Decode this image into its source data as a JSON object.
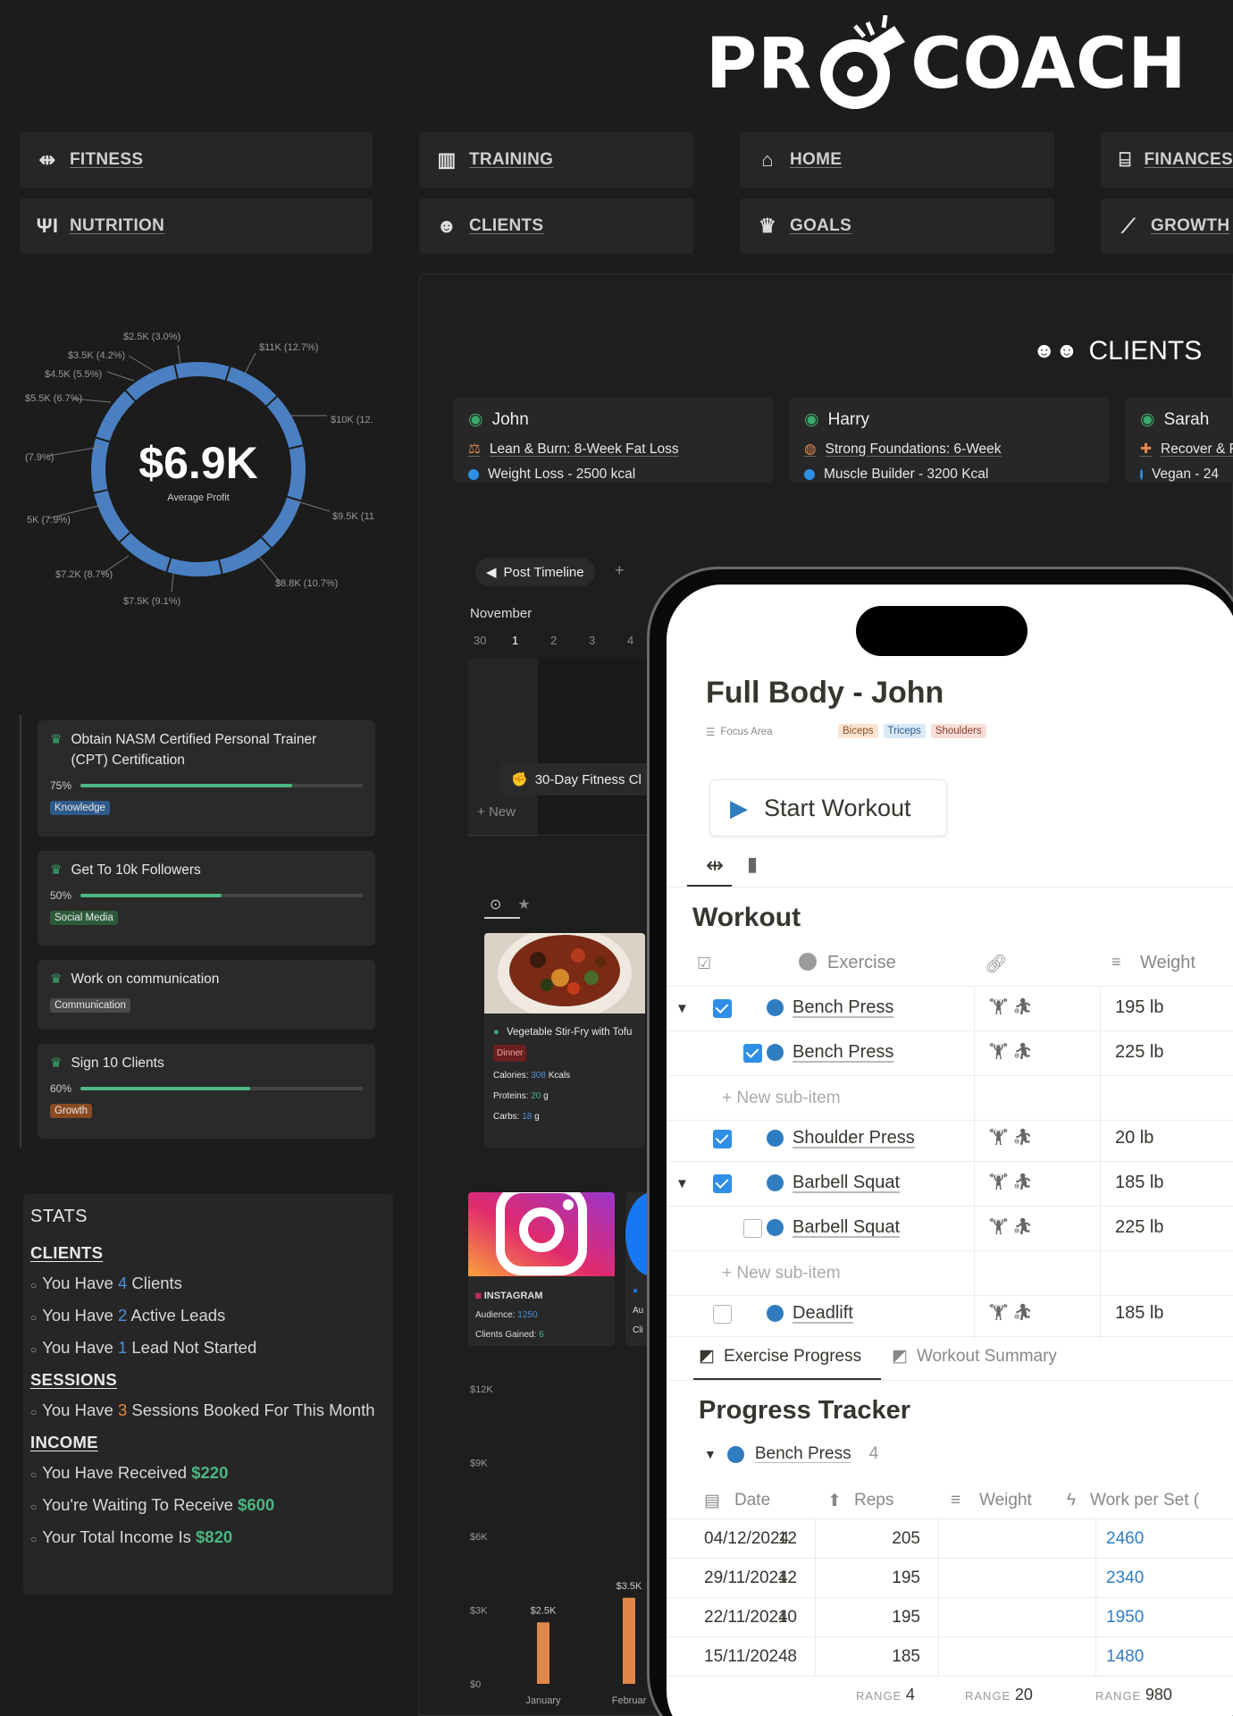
{
  "brand": {
    "name_a": "PR",
    "name_b": "COACH"
  },
  "nav": [
    {
      "label": "FITNESS",
      "icon": "dumbbell-icon"
    },
    {
      "label": "TRAINING",
      "icon": "map-icon"
    },
    {
      "label": "HOME",
      "icon": "home-icon"
    },
    {
      "label": "FINANCES",
      "icon": "bank-icon"
    },
    {
      "label": "NUTRITION",
      "icon": "utensils-icon"
    },
    {
      "label": "CLIENTS",
      "icon": "users-icon"
    },
    {
      "label": "GOALS",
      "icon": "trophy-icon"
    },
    {
      "label": "GROWTH",
      "icon": "chart-line-icon"
    }
  ],
  "donut": {
    "value": "$6.9K",
    "caption": "Average Profit",
    "labels": [
      "$2.5K (3.0%)",
      "$3.5K (4.2%)",
      "$4.5K (5.5%)",
      "$5.5K (6.7%)",
      "(7.9%)",
      "5K (7.9%)",
      "$7.2K (8.7%)",
      "$7.5K (9.1%)",
      "$8.8K (10.7%)",
      "$9.5K (11",
      "$10K (12.",
      "$11K (12.7%)"
    ]
  },
  "goals": [
    {
      "title": "Obtain NASM Certified Personal Trainer (CPT) Certification",
      "percent": "75%",
      "progress": 0.75,
      "tag": "Knowledge",
      "tag_color": "#2e5a8a"
    },
    {
      "title": "Get To 10k Followers",
      "percent": "50%",
      "progress": 0.5,
      "tag": "Social Media",
      "tag_color": "#2d5b3a"
    },
    {
      "title": "Work on communication",
      "tag": "Communication",
      "tag_color": "#4a4a4a"
    },
    {
      "title": "Sign 10 Clients",
      "percent": "60%",
      "progress": 0.6,
      "tag": "Growth",
      "tag_color": "#8a4b22"
    }
  ],
  "stats": {
    "heading": "STATS",
    "clients_h": "CLIENTS",
    "c1": [
      "You Have ",
      "4",
      " Clients"
    ],
    "c2": [
      "You Have ",
      "2",
      " Active Leads"
    ],
    "c3": [
      "You Have ",
      "1",
      " Lead Not Started"
    ],
    "sessions_h": "SESSIONS",
    "s1": [
      "You Have ",
      "3",
      " Sessions Booked For This Month"
    ],
    "income_h": "INCOME",
    "i1": [
      "You Have Received ",
      "$220"
    ],
    "i2": [
      "You're Waiting To Receive ",
      "$600"
    ],
    "i3": [
      "Your Total Income Is ",
      "$820"
    ]
  },
  "clients_section": {
    "title": "CLIENTS"
  },
  "clients": [
    {
      "name": "John",
      "program": "Lean & Burn: 8-Week Fat Loss",
      "plan": "Weight Loss - 2500 kcal"
    },
    {
      "name": "Harry",
      "program": "Strong Foundations: 6-Week",
      "plan": "Muscle Builder - 3200 Kcal"
    },
    {
      "name": "Sarah",
      "program": "Recover & F",
      "plan": "Vegan - 24"
    }
  ],
  "timeline": {
    "tab": "Post Timeline",
    "month": "November",
    "days": [
      "30",
      "1",
      "2",
      "3",
      "4"
    ],
    "event": "30-Day Fitness Cl",
    "new": "New"
  },
  "meal": {
    "title": "Vegetable Stir-Fry with Tofu",
    "tag": "Dinner",
    "calories": "Calories:",
    "cal_v": "308",
    "cal_u": "Kcals",
    "proteins": "Proteins:",
    "prot_v": "20",
    "prot_u": "g",
    "carbs": "Carbs:",
    "carb_v": "18",
    "carb_u": "g"
  },
  "social": {
    "name": "INSTAGRAM",
    "audience": "Audience:",
    "audience_v": "1250",
    "gained": "Clients Gained:",
    "gained_v": "6",
    "name2_a": "Au",
    "name2_b": "Cli"
  },
  "chart_data": {
    "type": "bar",
    "categories": [
      "January",
      "Februar"
    ],
    "values": [
      2500,
      3500
    ],
    "value_labels": [
      "$2.5K",
      "$3.5K"
    ],
    "ylim": [
      0,
      12000
    ],
    "yticks": [
      "$0",
      "$3K",
      "$6K",
      "$9K",
      "$12K"
    ],
    "colors": {
      "bar": "#e0884a"
    }
  },
  "phone": {
    "title": "Full Body - John",
    "focus_label": "Focus Area",
    "focus": [
      "Biceps",
      "Triceps",
      "Shoulders"
    ],
    "start": "Start Workout",
    "section": "Workout",
    "col_exercise": "Exercise",
    "col_weight": "Weight",
    "rows": [
      {
        "exercise": "Bench Press",
        "weight": "195 lb"
      },
      {
        "exercise": "Bench Press",
        "weight": "225 lb"
      },
      {
        "new": "New sub-item"
      },
      {
        "exercise": "Shoulder Press",
        "weight": "20 lb"
      },
      {
        "exercise": "Barbell Squat",
        "weight": "185 lb"
      },
      {
        "exercise": "Barbell Squat",
        "weight": "225 lb"
      },
      {
        "new": "New sub-item"
      },
      {
        "exercise": "Deadlift",
        "weight": "185 lb"
      }
    ],
    "tab1": "Exercise Progress",
    "tab2": "Workout Summary",
    "tracker": "Progress Tracker",
    "group": "Bench Press",
    "group_count": "4",
    "h_date": "Date",
    "h_reps": "Reps",
    "h_weight": "Weight",
    "h_work": "Work per Set (",
    "prog": [
      {
        "date": "04/12/2024",
        "reps": "12",
        "weight": "205",
        "work": "2460"
      },
      {
        "date": "29/11/2024",
        "reps": "12",
        "weight": "195",
        "work": "2340"
      },
      {
        "date": "22/11/2024",
        "reps": "10",
        "weight": "195",
        "work": "1950"
      },
      {
        "date": "15/11/2024",
        "reps": "8",
        "weight": "185",
        "work": "1480"
      }
    ],
    "range_label": "RANGE",
    "range_reps": "4",
    "range_weight": "20",
    "range_work": "980"
  }
}
